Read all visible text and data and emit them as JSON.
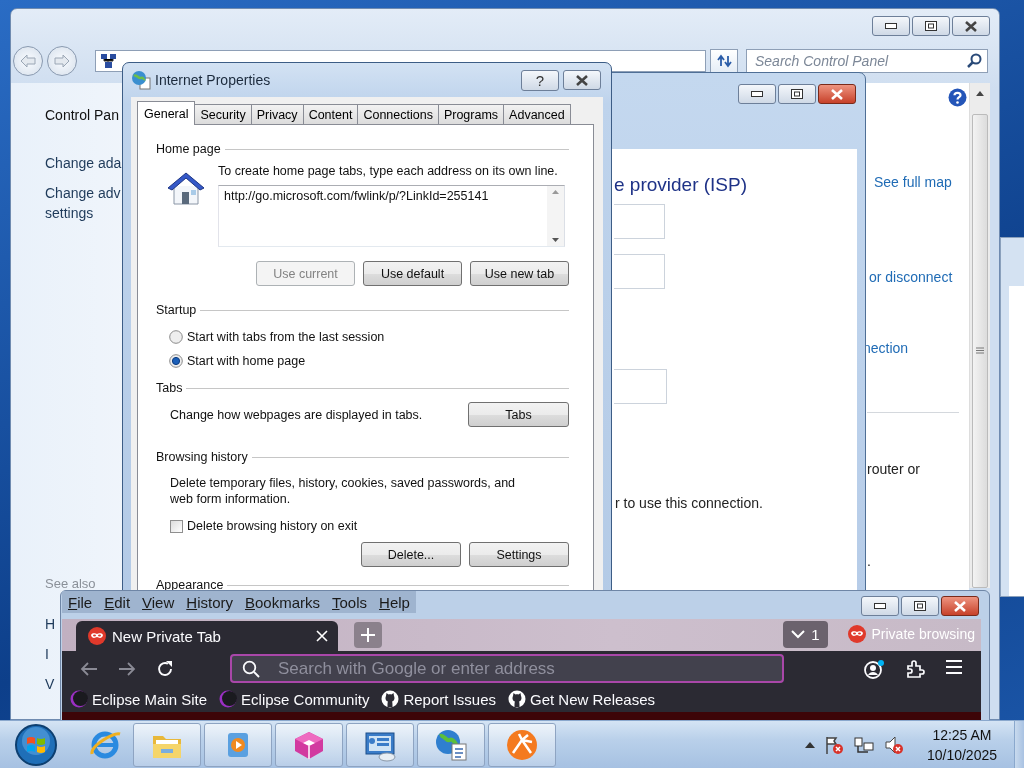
{
  "control_panel": {
    "search": {
      "placeholder": "Search Control Panel"
    },
    "sidebar": {
      "heading": "Control Pan",
      "links": [
        {
          "lines": [
            "Change ada"
          ]
        },
        {
          "lines": [
            "Change adv",
            "settings"
          ]
        }
      ],
      "see_also": "See also",
      "see_also_items": [
        "H",
        "I",
        "V"
      ]
    },
    "content": [
      {
        "kind": "link",
        "text": "See full map"
      },
      {
        "kind": "link",
        "text": "or disconnect"
      },
      {
        "kind": "link",
        "text": "nection"
      },
      {
        "kind": "text",
        "text": "router or"
      },
      {
        "kind": "text",
        "text": "."
      }
    ]
  },
  "wizard": {
    "heading": "e provider (ISP)",
    "note": "r to use this connection."
  },
  "dialog": {
    "title": "Internet Properties",
    "help": "?",
    "tabs": [
      {
        "label": "General",
        "selected": true
      },
      {
        "label": "Security",
        "selected": false
      },
      {
        "label": "Privacy",
        "selected": false
      },
      {
        "label": "Content",
        "selected": false
      },
      {
        "label": "Connections",
        "selected": false
      },
      {
        "label": "Programs",
        "selected": false
      },
      {
        "label": "Advanced",
        "selected": false
      }
    ],
    "home_page": {
      "label": "Home page",
      "hint": "To create home page tabs, type each address on its own line.",
      "url": "http://go.microsoft.com/fwlink/p/?LinkId=255141",
      "buttons": [
        {
          "label": "Use current",
          "disabled": true
        },
        {
          "label": "Use default",
          "disabled": false
        },
        {
          "label": "Use new tab",
          "disabled": false
        }
      ]
    },
    "startup": {
      "label": "Startup",
      "options": [
        {
          "label": "Start with tabs from the last session",
          "selected": false
        },
        {
          "label": "Start with home page",
          "selected": true
        }
      ]
    },
    "tabs_section": {
      "label": "Tabs",
      "text": "Change how webpages are displayed in tabs.",
      "button": "Tabs"
    },
    "history": {
      "label": "Browsing history",
      "text": "Delete temporary files, history, cookies, saved passwords, and web form information.",
      "checkbox": {
        "label": "Delete browsing history on exit",
        "checked": false
      },
      "buttons": [
        "Delete...",
        "Settings"
      ]
    },
    "appearance": {
      "label": "Appearance"
    }
  },
  "firefox": {
    "menu": [
      "File",
      "Edit",
      "View",
      "History",
      "Bookmarks",
      "Tools",
      "Help"
    ],
    "tab": {
      "title": "New Private Tab"
    },
    "tab_count": "1",
    "private_label": "Private browsing",
    "address": {
      "placeholder": "Search with Google or enter address"
    },
    "bookmarks": [
      {
        "kind": "sphere",
        "label": "Eclipse Main Site"
      },
      {
        "kind": "sphere",
        "label": "Eclipse Community"
      },
      {
        "kind": "cat",
        "label": "Report Issues"
      },
      {
        "kind": "cat",
        "label": "Get New Releases"
      }
    ]
  },
  "taskbar": {
    "apps": [
      {
        "kind": "ie",
        "running": false
      },
      {
        "kind": "folder",
        "running": true
      },
      {
        "kind": "media",
        "running": true
      },
      {
        "kind": "cube",
        "running": true
      },
      {
        "kind": "panel",
        "running": true
      },
      {
        "kind": "globe",
        "running": true
      },
      {
        "kind": "sunburst",
        "running": true
      }
    ],
    "clock": {
      "time": "12:25 AM",
      "date": "10/10/2025"
    }
  }
}
